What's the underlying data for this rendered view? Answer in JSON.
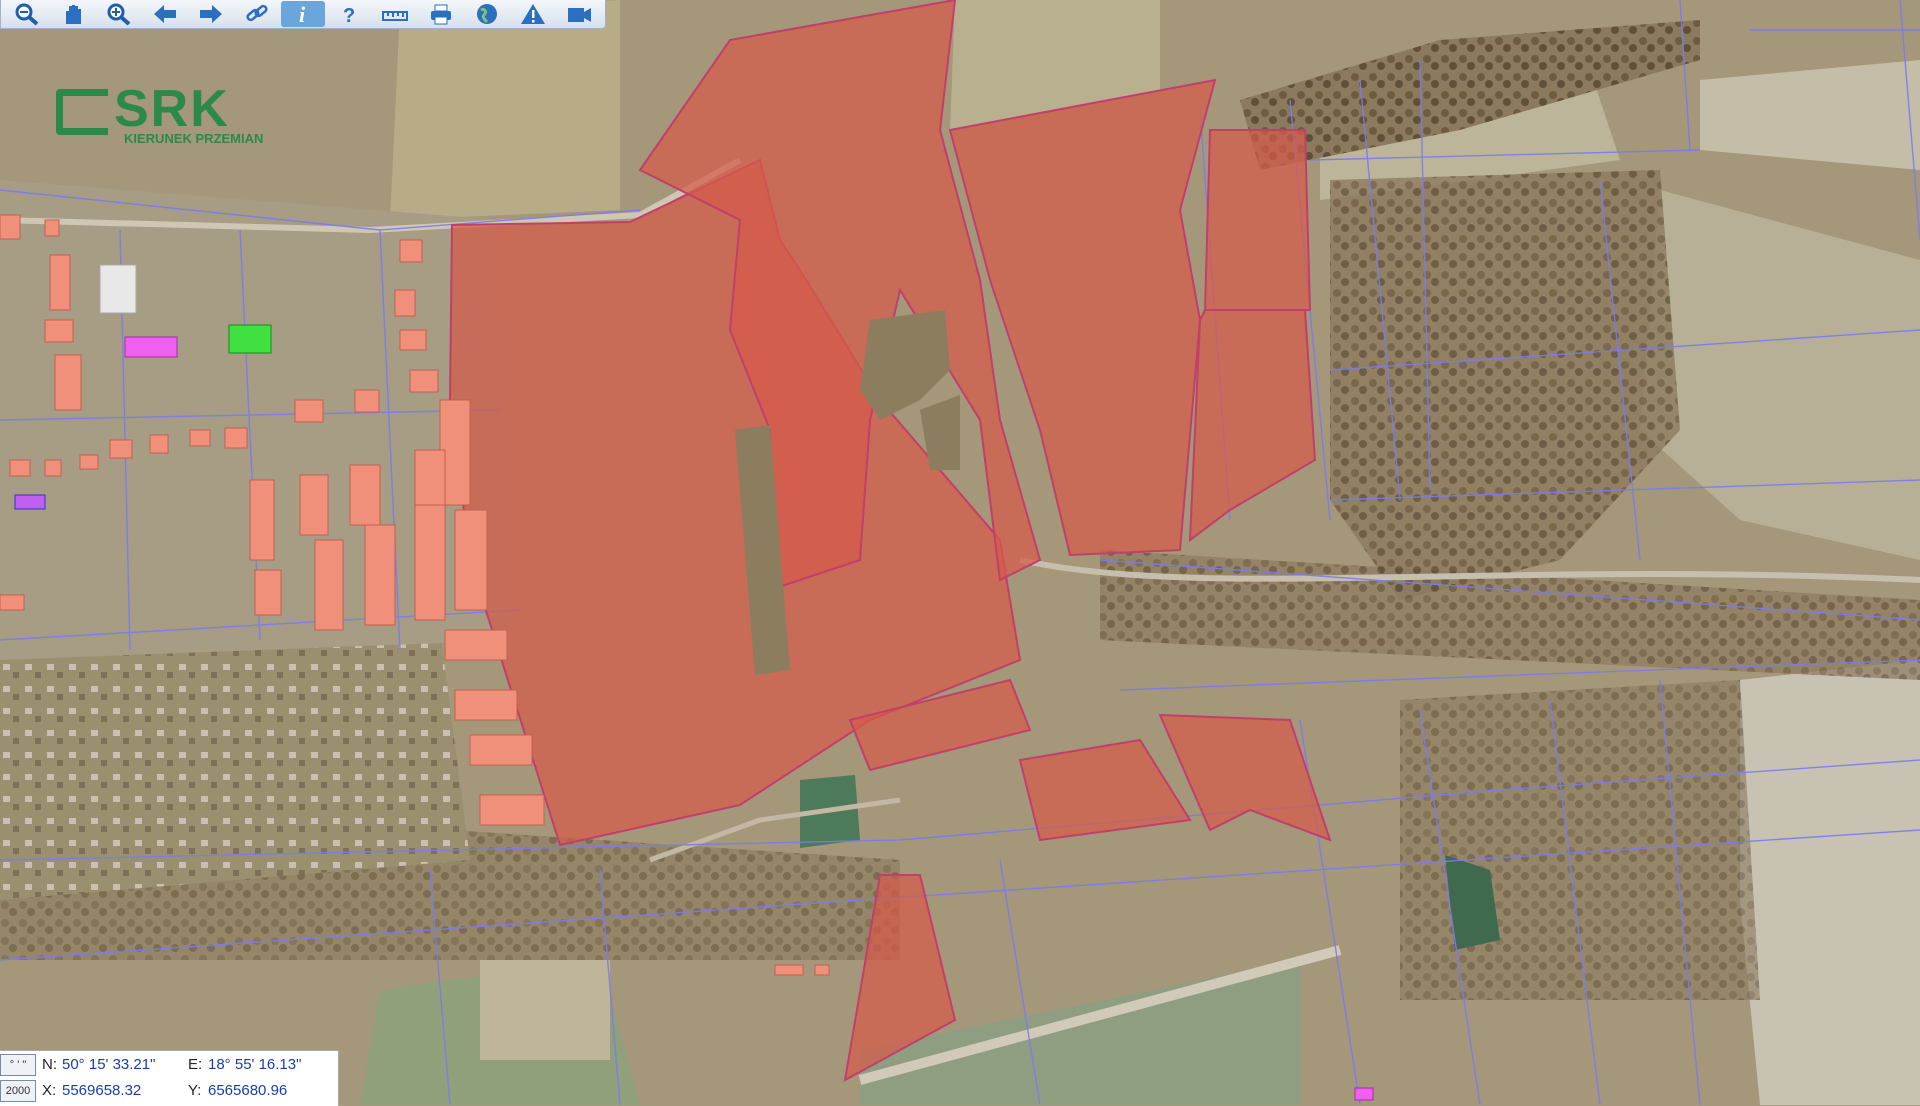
{
  "toolbar": {
    "tools": [
      {
        "name": "zoom-out-icon"
      },
      {
        "name": "pan-hand-icon"
      },
      {
        "name": "zoom-in-icon"
      },
      {
        "name": "back-arrow-icon"
      },
      {
        "name": "forward-arrow-icon"
      },
      {
        "name": "link-icon"
      },
      {
        "name": "info-icon",
        "active": true
      },
      {
        "name": "help-query-icon"
      },
      {
        "name": "ruler-icon"
      },
      {
        "name": "print-icon"
      },
      {
        "name": "globe-icon"
      },
      {
        "name": "warning-icon"
      },
      {
        "name": "export-icon"
      }
    ]
  },
  "logo": {
    "mark": "SRK",
    "subtitle": "KIERUNEK PRZEMIAN"
  },
  "coords": {
    "box_top": "° ' \"",
    "box_bottom": "2000",
    "n_label": "N:",
    "n_value": "50° 15' 33.21\"",
    "e_label": "E:",
    "e_value": "18° 55' 16.13\"",
    "x_label": "X:",
    "x_value": "5569658.32",
    "y_label": "Y:",
    "y_value": "6565680.96"
  },
  "colors": {
    "parcel_highlight": "#d65a4a",
    "parcel_border": "#c0406a",
    "parcel_lines": "#7b7bf0",
    "building": "#f0907a",
    "building_green": "#3fe03f",
    "building_magenta": "#f060f0",
    "logo_green": "#2b8a4a",
    "active_tool": "#6aa6db"
  }
}
